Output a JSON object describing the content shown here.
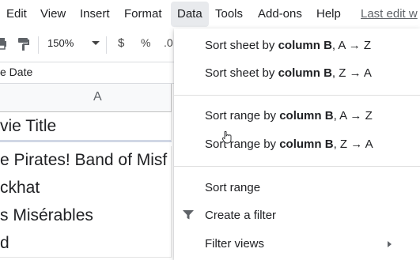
{
  "menubar": {
    "items": [
      "Edit",
      "View",
      "Insert",
      "Format",
      "Data",
      "Tools",
      "Add-ons",
      "Help"
    ],
    "last_edit": "Last edit w"
  },
  "toolbar": {
    "zoom": "150%",
    "currency": "$",
    "percent": "%",
    "decimal": ".0"
  },
  "formula_bar": {
    "text": "e Date"
  },
  "sheet": {
    "column_letter": "A",
    "cells": [
      "vie Title",
      "e Pirates! Band of Misf",
      "ckhat",
      "s Misérables",
      "d"
    ]
  },
  "data_menu": {
    "sort_sheet_az": {
      "prefix": "Sort sheet by ",
      "bold": "column B",
      "suffix": ", A → Z"
    },
    "sort_sheet_za": {
      "prefix": "Sort sheet by ",
      "bold": "column B",
      "suffix": ", Z → A"
    },
    "sort_range_az": {
      "prefix": "Sort range by ",
      "bold": "column B",
      "suffix": ", A → Z"
    },
    "sort_range_za": {
      "prefix": "Sort range by ",
      "bold": "column B",
      "suffix": ", Z → A"
    },
    "sort_range": "Sort range",
    "create_filter": "Create a filter",
    "filter_views": "Filter views"
  },
  "icons": {
    "print": "print-icon",
    "paint_format": "paint-format-icon",
    "filter": "filter-icon",
    "submenu": "chevron-right-icon",
    "cursor": "pointer-cursor-icon"
  },
  "colors": {
    "menu_active_bg": "#e8eaed",
    "header_bg": "#f8f9fa",
    "text": "#202124",
    "muted": "#5f6368"
  }
}
